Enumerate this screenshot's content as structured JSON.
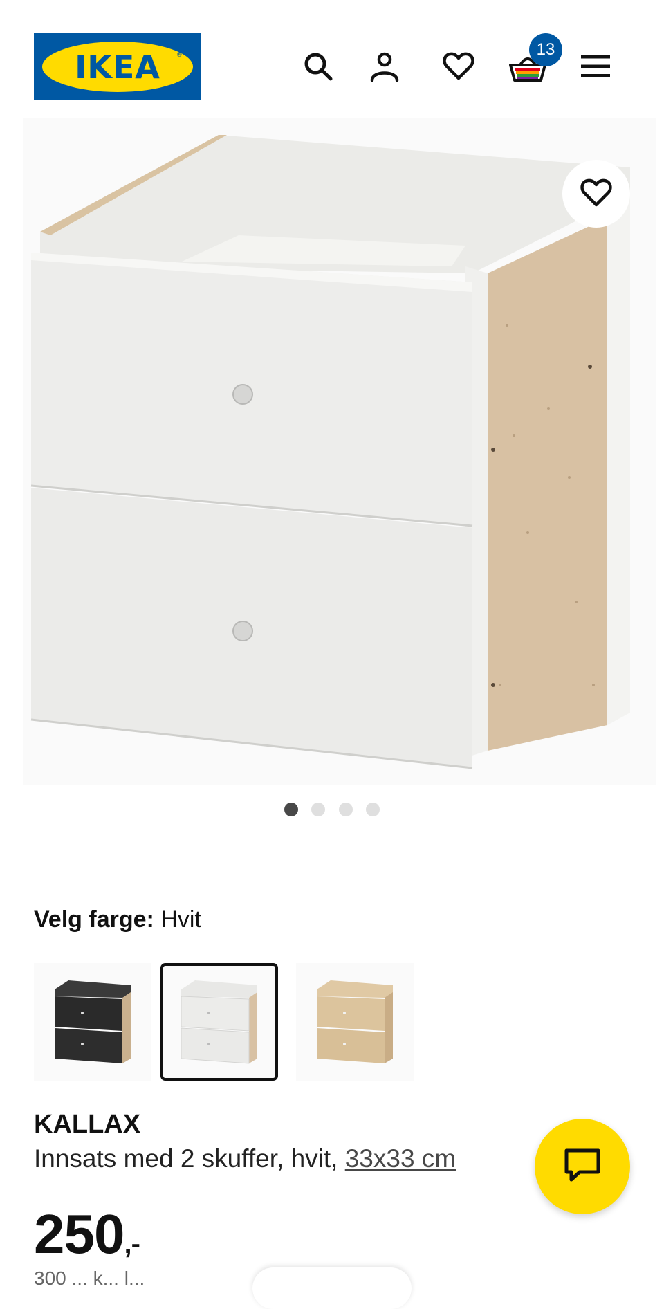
{
  "header": {
    "logo_text": "IKEA",
    "cart_count": "13",
    "icons": [
      "search-icon",
      "account-icon",
      "heart-icon",
      "cart-icon",
      "menu-icon"
    ]
  },
  "gallery": {
    "image_count": 4,
    "active_index": 0
  },
  "color": {
    "label": "Velg farge:",
    "value": "Hvit",
    "options": [
      "Svartbrun",
      "Hvit",
      "Hvitbeiset eikemønstret"
    ],
    "selected_index": 1
  },
  "product": {
    "name": "KALLAX",
    "description": "Innsats med 2 skuffer, hvit, ",
    "size_link": "33x33 cm",
    "price": "250",
    "price_suffix": ",-"
  },
  "partial_text": "300 ... k... l...",
  "colors": {
    "brand_blue": "#0058a3",
    "brand_yellow": "#ffdb00"
  }
}
